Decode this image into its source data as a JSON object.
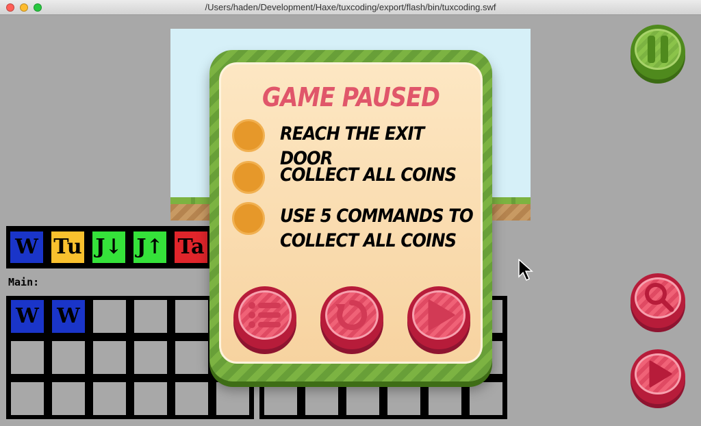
{
  "window": {
    "title": "/Users/haden/Development/Haxe/tuxcoding/export/flash/bin/tuxcoding.swf"
  },
  "colors": {
    "background": "#a8a8a8",
    "sky": "#d6f0f8",
    "accent_red": "#e0566a",
    "accent_green": "#7cb342",
    "goal_orange": "#e6982a",
    "cmd_walk": "#1a35c9",
    "cmd_turn": "#f9c12e",
    "cmd_jump": "#35e23a",
    "cmd_take": "#e0252b"
  },
  "palette": [
    {
      "label": "W",
      "color": "#1a35c9"
    },
    {
      "label": "Tu",
      "color": "#f9c12e"
    },
    {
      "label": "J↓",
      "color": "#35e23a"
    },
    {
      "label": "J↑",
      "color": "#35e23a"
    },
    {
      "label": "Ta",
      "color": "#e0252b"
    }
  ],
  "program": {
    "label": "Main:",
    "filled_slots": [
      "W",
      "W"
    ]
  },
  "dialog": {
    "title": "GAME PAUSED",
    "goals": [
      "REACH THE EXIT DOOR",
      "COLLECT ALL COINS",
      "USE 5 COMMANDS TO COLLECT ALL COINS"
    ],
    "buttons": [
      "menu-icon",
      "restart-icon",
      "play-icon"
    ]
  },
  "side_buttons": [
    "pause-icon",
    "search-icon",
    "play-icon"
  ]
}
